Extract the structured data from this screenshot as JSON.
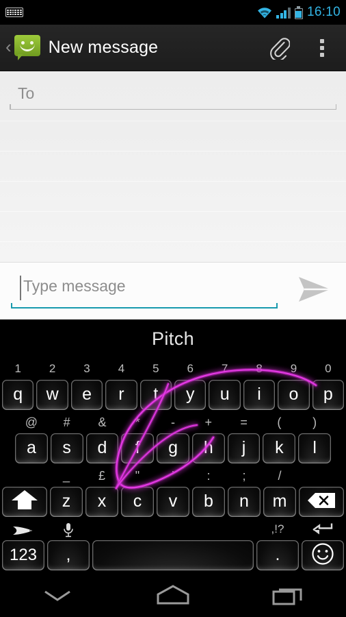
{
  "status_bar": {
    "left_icon": "keyboard-icon",
    "wifi_icon": "wifi-icon",
    "signal_icon": "signal-icon",
    "battery_icon": "battery-icon",
    "time": "16:10",
    "accent_color": "#33b5e5"
  },
  "action_bar": {
    "back_label": "‹",
    "app_icon": "sms-bubble-icon",
    "title": "New message",
    "attach_icon": "paperclip-icon",
    "overflow_icon": "overflow-menu-icon"
  },
  "compose": {
    "to_placeholder": "To",
    "to_value": "",
    "message_placeholder": "Type message",
    "message_value": "",
    "send_icon": "send-arrow-icon",
    "focus_color": "#179aae"
  },
  "keyboard": {
    "name": "swype-keyboard",
    "suggestion": "Pitch",
    "gesture_trail_color": "#d02ad0",
    "row1": [
      {
        "key": "q",
        "alt": "1"
      },
      {
        "key": "w",
        "alt": "2"
      },
      {
        "key": "e",
        "alt": "3"
      },
      {
        "key": "r",
        "alt": "4"
      },
      {
        "key": "t",
        "alt": "5"
      },
      {
        "key": "y",
        "alt": "6"
      },
      {
        "key": "u",
        "alt": "7"
      },
      {
        "key": "i",
        "alt": "8"
      },
      {
        "key": "o",
        "alt": "9"
      },
      {
        "key": "p",
        "alt": "0"
      }
    ],
    "row2": [
      {
        "key": "a",
        "alt": "@"
      },
      {
        "key": "s",
        "alt": "#"
      },
      {
        "key": "d",
        "alt": "&"
      },
      {
        "key": "f",
        "alt": "*"
      },
      {
        "key": "g",
        "alt": "-"
      },
      {
        "key": "h",
        "alt": "+"
      },
      {
        "key": "j",
        "alt": "="
      },
      {
        "key": "k",
        "alt": "("
      },
      {
        "key": "l",
        "alt": ")"
      }
    ],
    "row3": [
      {
        "key": "z",
        "alt": "_"
      },
      {
        "key": "x",
        "alt": "£"
      },
      {
        "key": "c",
        "alt": "\""
      },
      {
        "key": "v",
        "alt": "'"
      },
      {
        "key": "b",
        "alt": ":"
      },
      {
        "key": "n",
        "alt": ";"
      },
      {
        "key": "m",
        "alt": "/"
      }
    ],
    "shift_icon": "shift-arrow-icon",
    "backspace_icon": "backspace-icon",
    "fn_key": {
      "label": "123",
      "icon": "swype-logo-icon"
    },
    "comma_key": {
      "label": ",",
      "alt_icon": "microphone-icon"
    },
    "space_key": {
      "label": "",
      "name": "spacebar"
    },
    "period_key": {
      "label": ".",
      "alt": ",!?"
    },
    "emoji_key": {
      "icon": "smiley-icon",
      "alt_icon": "enter-arrow-icon"
    }
  },
  "nav_bar": {
    "back_icon": "hide-keyboard-chevron-icon",
    "home_icon": "home-icon",
    "recents_icon": "recent-apps-icon"
  }
}
